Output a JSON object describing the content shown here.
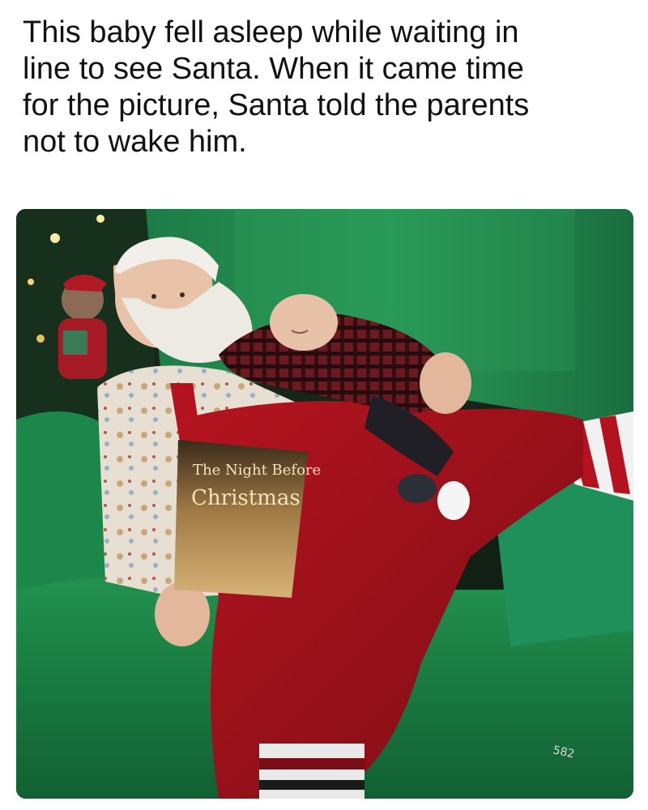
{
  "post": {
    "caption": "This baby fell asleep while waiting in\nline to see Santa. When it came time\nfor the picture, Santa told the parents\nnot to wake him."
  },
  "photo": {
    "book_title_line1": "The Night Before",
    "book_title_line2": "Christmas",
    "corner_number": "582",
    "colors": {
      "chair_green": "#1f8a4c",
      "chair_dark": "#146238",
      "santa_red": "#a3121c",
      "beard_white": "#ece8e2",
      "flannel_red": "#7a1a22"
    }
  }
}
